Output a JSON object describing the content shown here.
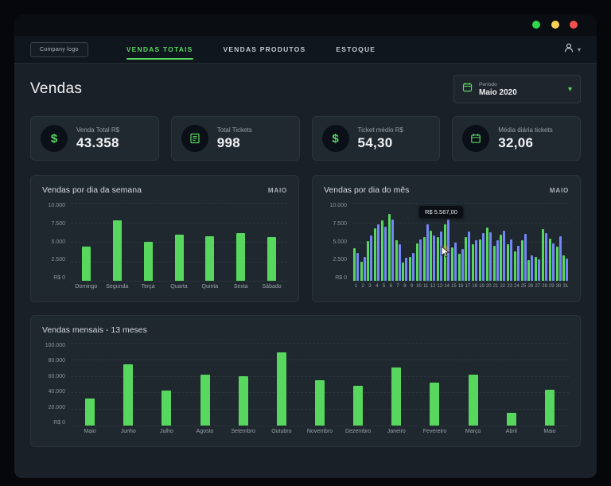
{
  "window": {
    "traffic_lights": [
      {
        "name": "green-light",
        "color": "#32d74b"
      },
      {
        "name": "yellow-light",
        "color": "#f7d154"
      },
      {
        "name": "red-light",
        "color": "#f4504e"
      }
    ]
  },
  "nav": {
    "logo_label": "Company logo",
    "tabs": [
      {
        "label": "VENDAS TOTAIS",
        "active": true
      },
      {
        "label": "VENDAS PRODUTOS",
        "active": false
      },
      {
        "label": "ESTOQUE",
        "active": false
      }
    ]
  },
  "header": {
    "title": "Vendas",
    "period": {
      "label": "Período",
      "value": "Maio 2020"
    }
  },
  "kpis": [
    {
      "icon": "dollar-circle-icon",
      "label": "Venda Total R$",
      "value": "43.358"
    },
    {
      "icon": "receipt-icon",
      "label": "Total Tickets",
      "value": "998"
    },
    {
      "icon": "dollar-circle-icon",
      "label": "Ticket médio R$",
      "value": "54,30"
    },
    {
      "icon": "calendar-icon",
      "label": "Média diária tickets",
      "value": "32,06"
    }
  ],
  "colors": {
    "accent_green": "#58d75e",
    "bar_blue": "#7386f5"
  },
  "chart_data": [
    {
      "type": "bar",
      "title": "Vendas por dia da semana",
      "badge": "MAIO",
      "categories": [
        "Domingo",
        "Segunda",
        "Terça",
        "Quarta",
        "Quinta",
        "Sexta",
        "Sábado"
      ],
      "values": [
        4400,
        7800,
        5000,
        5900,
        5700,
        6100,
        5600
      ],
      "bar_color": "#58d75e",
      "yticks": [
        "10.000",
        "7.500",
        "5.000",
        "2.500",
        "R$ 0"
      ],
      "ylim": [
        0,
        10000
      ],
      "grid": true,
      "legend": false
    },
    {
      "type": "bar",
      "title": "Vendas por dia do mês",
      "badge": "MAIO",
      "categories": [
        "1",
        "2",
        "3",
        "4",
        "5",
        "6",
        "7",
        "8",
        "9",
        "10",
        "11",
        "12",
        "13",
        "14",
        "15",
        "16",
        "17",
        "18",
        "19",
        "20",
        "21",
        "22",
        "23",
        "24",
        "25",
        "26",
        "27",
        "28",
        "29",
        "30",
        "31"
      ],
      "series": [
        {
          "name": "green",
          "color": "#58d75e",
          "values": [
            4200,
            2400,
            5100,
            6700,
            7800,
            8600,
            5200,
            2300,
            3100,
            4800,
            5600,
            6400,
            5567,
            7200,
            4300,
            3500,
            5600,
            4700,
            5300,
            6800,
            4500,
            5900,
            4700,
            3800,
            5200,
            2700,
            3100,
            6600,
            5400,
            4400,
            3300
          ]
        },
        {
          "name": "blue",
          "color": "#7386f5",
          "values": [
            3600,
            3100,
            5800,
            7200,
            6900,
            7900,
            4700,
            3000,
            3600,
            5300,
            7200,
            5800,
            6300,
            7900,
            4900,
            4100,
            6300,
            5200,
            6100,
            6200,
            5200,
            6400,
            5300,
            4500,
            6000,
            3300,
            2800,
            6100,
            4800,
            5700,
            2900
          ]
        }
      ],
      "tooltip": {
        "label": "R$ 5.567,00"
      },
      "yticks": [
        "10.000",
        "7.500",
        "5.000",
        "2.500",
        "R$ 0"
      ],
      "ylim": [
        0,
        10000
      ],
      "grid": true,
      "legend": false
    },
    {
      "type": "bar",
      "title": "Vendas mensais - 13 meses",
      "categories": [
        "Maio",
        "Junho",
        "Julho",
        "Agosto",
        "Setembro",
        "Outubro",
        "Novembro",
        "Dezembro",
        "Janeiro",
        "Fevereiro",
        "Março",
        "Abril",
        "Maio"
      ],
      "values": [
        33000,
        74000,
        42000,
        62000,
        60000,
        88000,
        55000,
        48000,
        70000,
        52000,
        62000,
        15000,
        43000
      ],
      "bar_color": "#58d75e",
      "yticks": [
        "100.000",
        "80.000",
        "60.000",
        "40.000",
        "20.000",
        "R$ 0"
      ],
      "ylim": [
        0,
        100000
      ],
      "grid": true,
      "legend": false
    }
  ]
}
